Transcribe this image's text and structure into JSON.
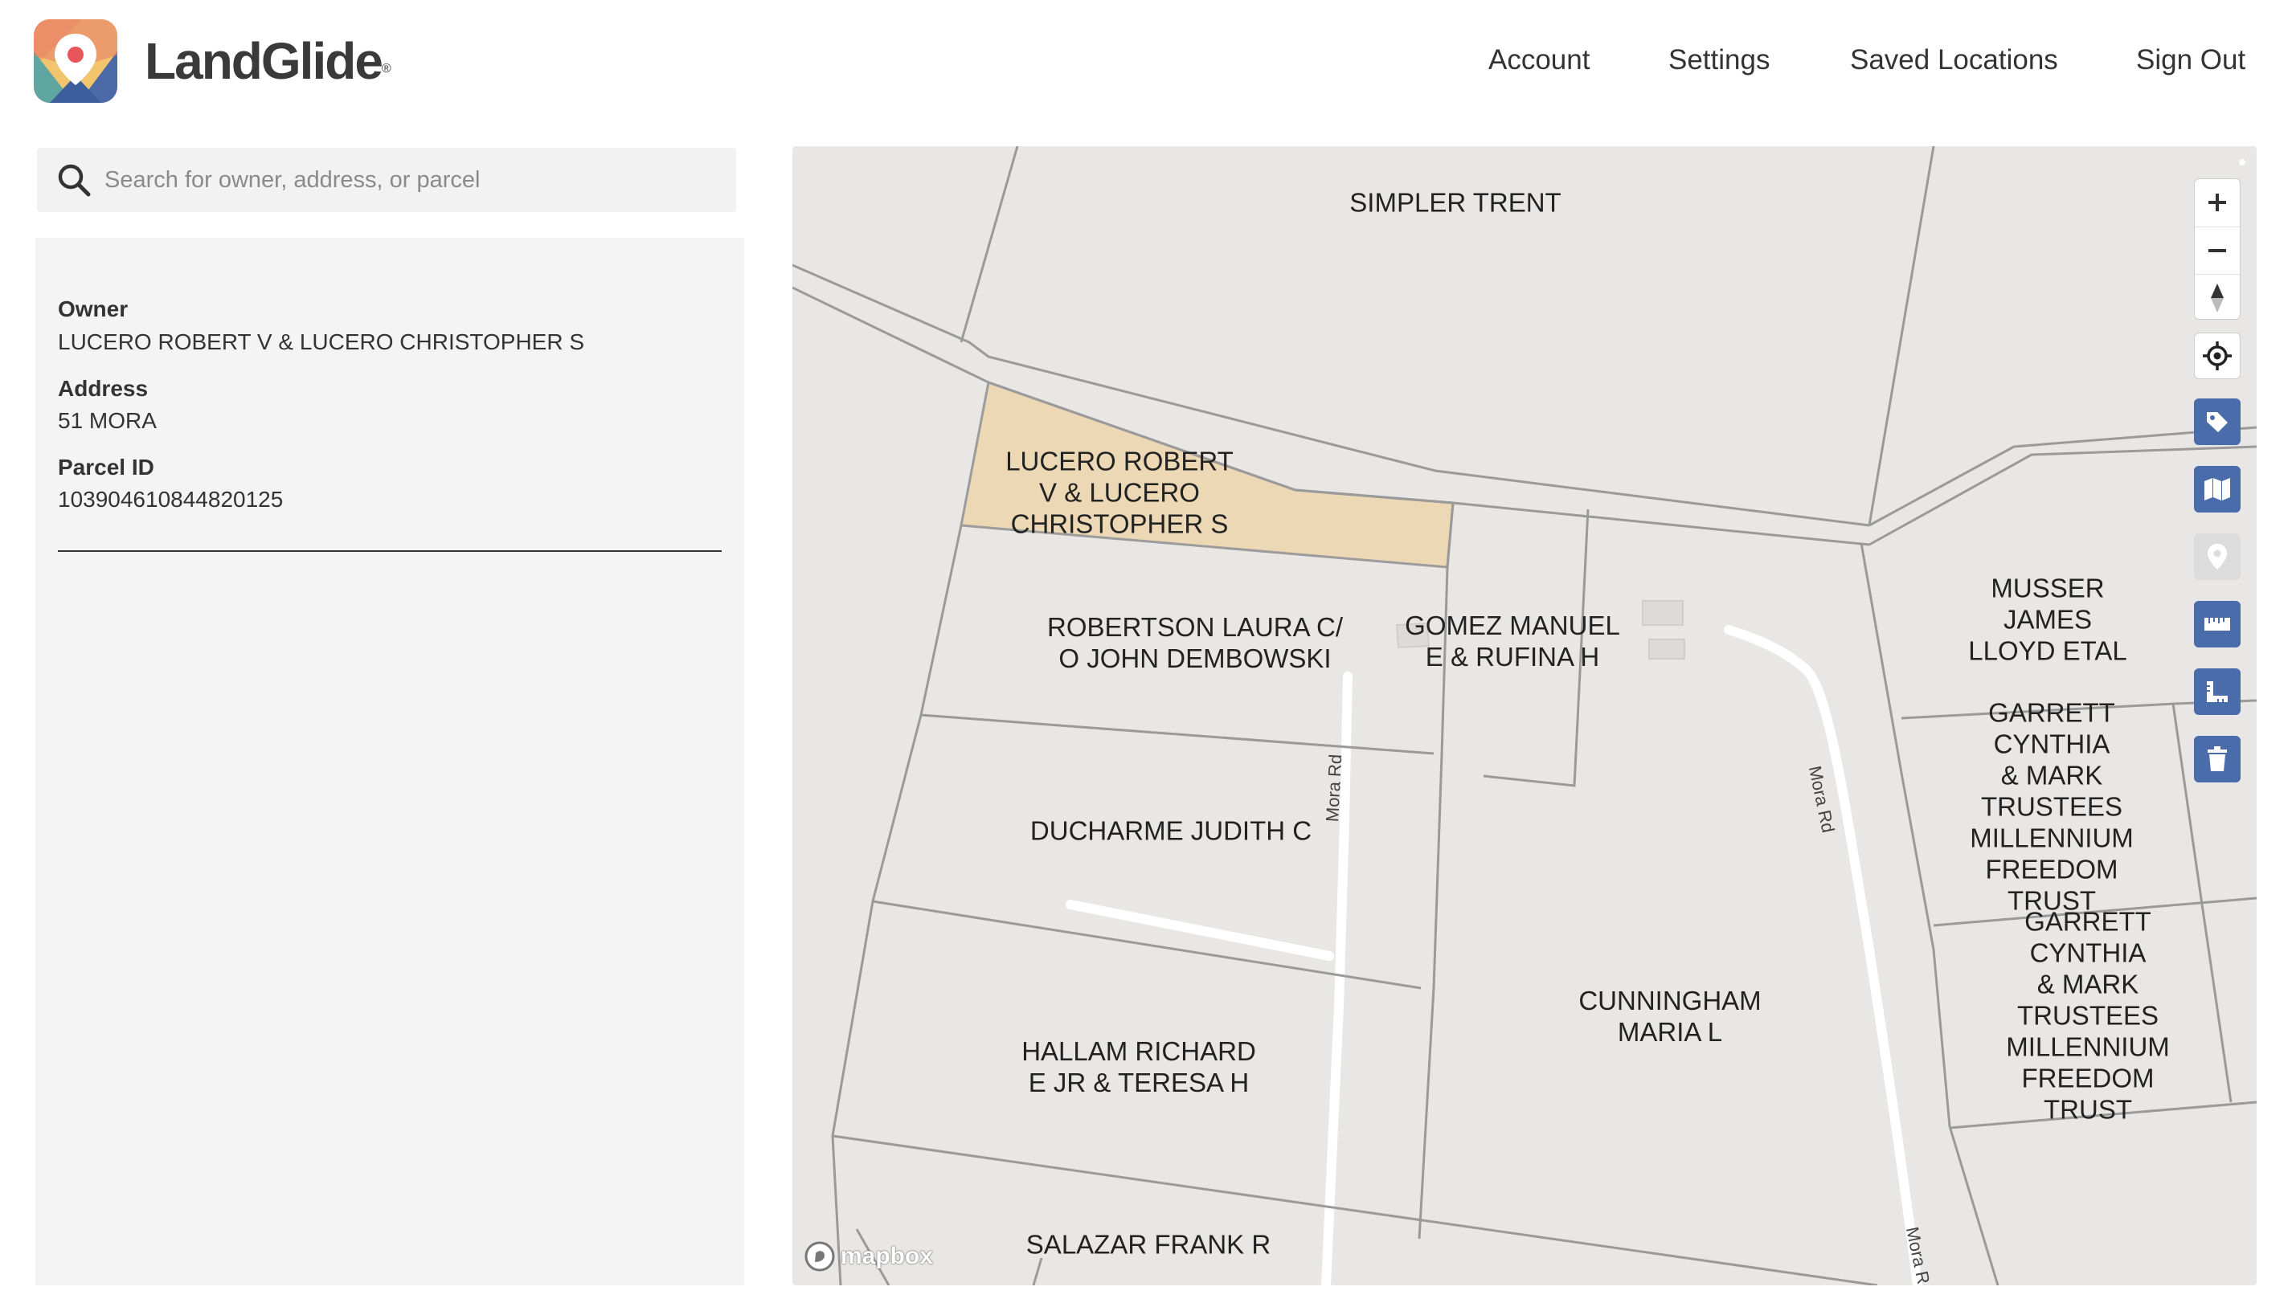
{
  "app": {
    "name": "LandGlide",
    "trademark": "®"
  },
  "nav": {
    "account": "Account",
    "settings": "Settings",
    "saved_locations": "Saved Locations",
    "sign_out": "Sign Out"
  },
  "search": {
    "placeholder": "Search for owner, address, or parcel",
    "value": ""
  },
  "parcel_info": {
    "owner_label": "Owner",
    "owner_value": "LUCERO ROBERT V & LUCERO CHRISTOPHER S",
    "address_label": "Address",
    "address_value": "51 MORA",
    "parcel_id_label": "Parcel ID",
    "parcel_id_value": "103904610844820125"
  },
  "map": {
    "selected_parcel_color": "#ecd8b4",
    "parcels": [
      {
        "name": "SIMPLER TRENT"
      },
      {
        "name": "LUCERO ROBERT\nV & LUCERO\nCHRISTOPHER S",
        "selected": true
      },
      {
        "name": "ROBERTSON LAURA C/\nO JOHN DEMBOWSKI"
      },
      {
        "name": "GOMEZ MANUEL\nE & RUFINA H"
      },
      {
        "name": "MUSSER JAMES\nLLOYD ETAL"
      },
      {
        "name": "GARRETT CYNTHIA\n& MARK TRUSTEES\nMILLENNIUM\nFREEDOM TRUST"
      },
      {
        "name": "DUCHARME JUDITH C"
      },
      {
        "name": "GARRETT CYNTHIA\n& MARK TRUSTEES\nMILLENNIUM\nFREEDOM TRUST"
      },
      {
        "name": "CUNNINGHAM\nMARIA L"
      },
      {
        "name": "HALLAM RICHARD\nE JR & TERESA H"
      },
      {
        "name": "SALAZAR FRANK R"
      }
    ],
    "roads": [
      "Mora Rd",
      "Mora Rd",
      "Mora R"
    ],
    "attribution": "mapbox",
    "controls": [
      {
        "name": "zoom-in",
        "icon": "plus-icon"
      },
      {
        "name": "zoom-out",
        "icon": "minus-icon"
      },
      {
        "name": "reset-north",
        "icon": "compass-icon"
      },
      {
        "name": "locate",
        "icon": "crosshair-icon"
      },
      {
        "name": "tag",
        "icon": "tag-icon"
      },
      {
        "name": "layers",
        "icon": "map-icon"
      },
      {
        "name": "drop-pin",
        "icon": "pin-icon",
        "disabled": true
      },
      {
        "name": "measure-distance",
        "icon": "ruler-icon"
      },
      {
        "name": "measure-area",
        "icon": "area-ruler-icon"
      },
      {
        "name": "clear",
        "icon": "trash-icon"
      }
    ]
  }
}
